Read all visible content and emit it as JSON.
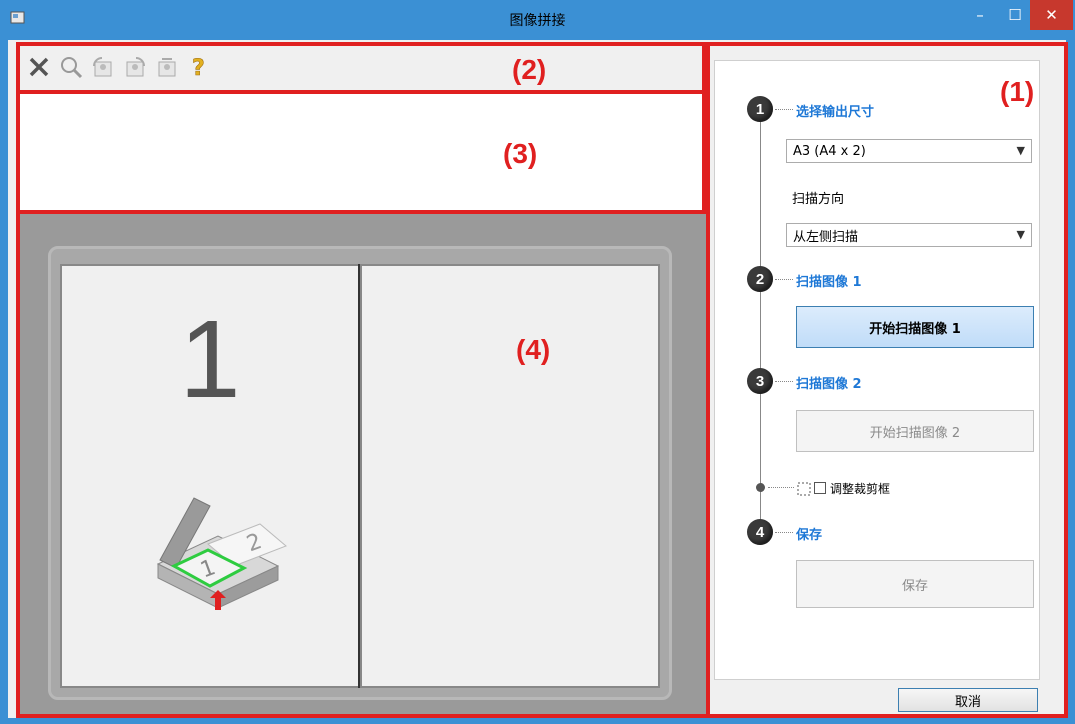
{
  "window": {
    "title": "图像拼接",
    "minimize": "–",
    "maximize": "☐",
    "close": "✕"
  },
  "region_labels": {
    "r1": "(1)",
    "r2": "(2)",
    "r3": "(3)",
    "r4": "(4)"
  },
  "toolbar": {
    "icons": [
      "close-icon",
      "zoom-icon",
      "rotate-left-icon",
      "rotate-right-icon",
      "swap-icon",
      "help-icon"
    ]
  },
  "preview": {
    "page_number": "1"
  },
  "panel": {
    "step1": {
      "number": "1",
      "label": "选择输出尺寸",
      "output_size": "A3 (A4 x 2)",
      "direction_label": "扫描方向",
      "direction_value": "从左侧扫描"
    },
    "step2": {
      "number": "2",
      "label": "扫描图像 1",
      "button": "开始扫描图像 1"
    },
    "step3": {
      "number": "3",
      "label": "扫描图像 2",
      "button": "开始扫描图像 2"
    },
    "adjust": {
      "label": "调整裁剪框"
    },
    "step4": {
      "number": "4",
      "label": "保存",
      "button": "保存"
    },
    "cancel": "取消"
  },
  "colors": {
    "accent": "#3b90d4",
    "highlight": "#e02020",
    "step_label": "#1e78d6"
  }
}
